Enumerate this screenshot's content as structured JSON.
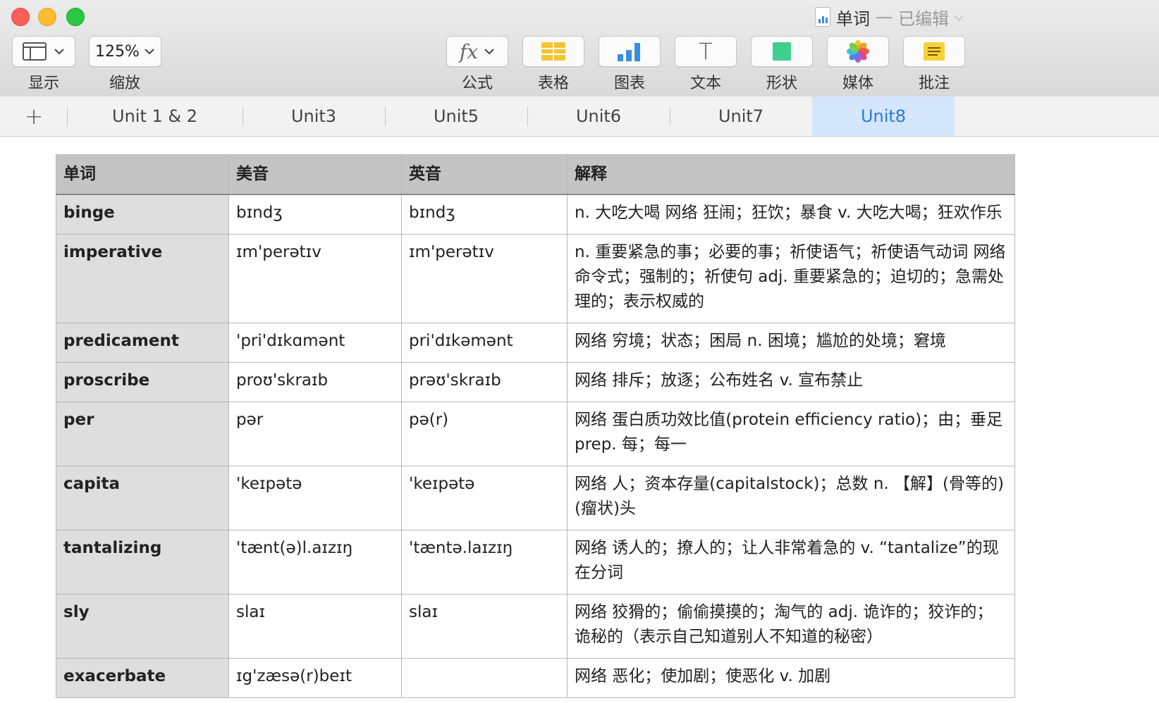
{
  "window": {
    "doc_name": "单词",
    "dash": "—",
    "doc_state": "已编辑"
  },
  "toolbar": {
    "left": [
      {
        "label": "显示",
        "icon": "sidebar-view-icon"
      },
      {
        "label": "缩放",
        "value": "125%"
      }
    ],
    "right": [
      {
        "label": "公式",
        "icon": "fx-icon",
        "glyph": "fx"
      },
      {
        "label": "表格",
        "icon": "table-icon"
      },
      {
        "label": "图表",
        "icon": "chart-icon"
      },
      {
        "label": "文本",
        "icon": "text-icon",
        "glyph": "T"
      },
      {
        "label": "形状",
        "icon": "shape-icon"
      },
      {
        "label": "媒体",
        "icon": "media-icon"
      },
      {
        "label": "批注",
        "icon": "comment-icon"
      }
    ]
  },
  "colors": {
    "accent_blue": "#2f7ad8",
    "active_tab_bg": "#d3e6fb",
    "header_bg": "#c4c4c4",
    "word_col_bg": "#dedede",
    "table_icon": "#f6c333",
    "chart_icon": "#3b8de0",
    "shape_icon": "#3fcf8e",
    "comment_icon": "#f7d13a"
  },
  "tabs": {
    "add_glyph": "+",
    "items": [
      "Unit 1 & 2",
      "Unit3",
      "Unit5",
      "Unit6",
      "Unit7",
      "Unit8"
    ],
    "active": "Unit8"
  },
  "table": {
    "headers": [
      "单词",
      "美音",
      "英音",
      "解释"
    ],
    "rows": [
      {
        "word": "binge",
        "us": "bɪndʒ",
        "uk": "bɪndʒ",
        "def": "n. 大吃大喝  网络 狂闹；狂饮；暴食  v. 大吃大喝；狂欢作乐"
      },
      {
        "word": "imperative",
        "us": "ɪm'perətɪv",
        "uk": "ɪm'perətɪv",
        "def": "n. 重要紧急的事；必要的事；祈使语气；祈使语气动词  网络 命令式；强制的；祈使句  adj. 重要紧急的；迫切的；急需处理的；表示权威的"
      },
      {
        "word": "predicament",
        "us": "'pri'dɪkɑmənt",
        "uk": "pri'dɪkəmənt",
        "def": "网络 穷境；状态；困局  n. 困境；尴尬的处境；窘境"
      },
      {
        "word": "proscribe",
        "us": "proʊ'skraɪb",
        "uk": "prəʊ'skraɪb",
        "def": "网络 排斥；放逐；公布姓名  v. 宣布禁止"
      },
      {
        "word": "per",
        "us": "pər",
        "uk": "pə(r)",
        "def": "网络 蛋白质功效比值(protein efficiency ratio)；由；垂足  prep. 每；每一"
      },
      {
        "word": "capita",
        "us": "'keɪpətə",
        "uk": "'keɪpətə",
        "def": "网络 人；资本存量(capitalstock)；总数  n. 【解】(骨等的)(瘤状)头"
      },
      {
        "word": "tantalizing",
        "us": "'tænt(ə)l.aɪzɪŋ",
        "uk": "'tæntə.laɪzɪŋ",
        "def": "网络 诱人的；撩人的；让人非常着急的  v. “tantalize”的现在分词"
      },
      {
        "word": "sly",
        "us": "slaɪ",
        "uk": "slaɪ",
        "def": "网络 狡猾的；偷偷摸摸的；淘气的  adj. 诡诈的；狡诈的；诡秘的（表示自己知道别人不知道的秘密）"
      },
      {
        "word": "exacerbate",
        "us": "ɪg'zæsə(r)beɪt",
        "uk": "",
        "def": "网络 恶化；使加剧；使恶化  v. 加剧"
      }
    ]
  }
}
